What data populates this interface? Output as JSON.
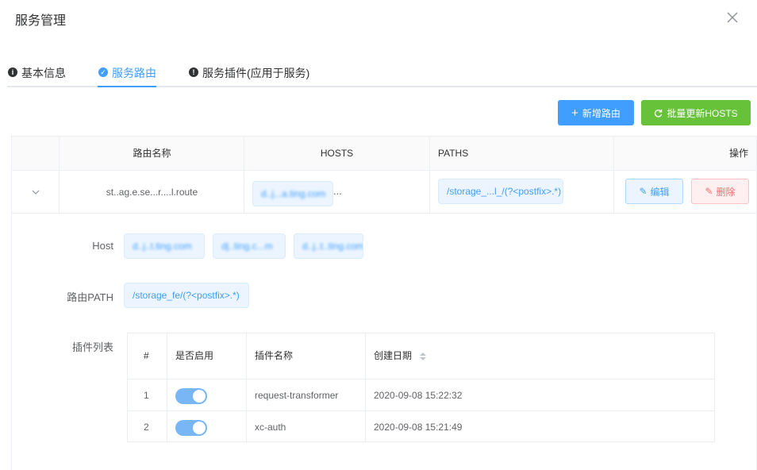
{
  "dialog": {
    "title": "服务管理"
  },
  "tabs": [
    {
      "label": "基本信息",
      "icon": "info-icon"
    },
    {
      "label": "服务路由",
      "icon": "check-circle-icon"
    },
    {
      "label": "服务插件(应用于服务)",
      "icon": "exclamation-icon"
    }
  ],
  "toolbar": {
    "add_route": "新增路由",
    "batch_update": "批量更新HOSTS"
  },
  "table": {
    "headers": {
      "name": "路由名称",
      "hosts": "HOSTS",
      "paths": "PATHS",
      "actions": "操作"
    },
    "row": {
      "name": "st..ag.e.se...r....l.route",
      "host_tag": "d..j...a.ting.com",
      "host_more": "...",
      "path_tag": "/storage_...l_/(?<postfix>.*)",
      "edit": "编辑",
      "delete": "删除"
    }
  },
  "expand": {
    "host_label": "Host",
    "hosts": [
      "d..j..t.ting.com",
      "dj..ting.c...m",
      "d..j..t..ting.com"
    ],
    "path_label": "路由PATH",
    "path": "/storage_fe/(?<postfix>.*)",
    "plugins_label": "插件列表",
    "plugin_headers": {
      "index": "#",
      "enabled": "是否启用",
      "name": "插件名称",
      "created": "创建日期"
    },
    "plugins": [
      {
        "index": "1",
        "enabled": true,
        "name": "request-transformer",
        "created": "2020-09-08 15:22:32"
      },
      {
        "index": "2",
        "enabled": true,
        "name": "xc-auth",
        "created": "2020-09-08 15:21:49"
      }
    ]
  },
  "colors": {
    "primary": "#409eff",
    "success": "#67c23a",
    "danger": "#f56c6c"
  }
}
